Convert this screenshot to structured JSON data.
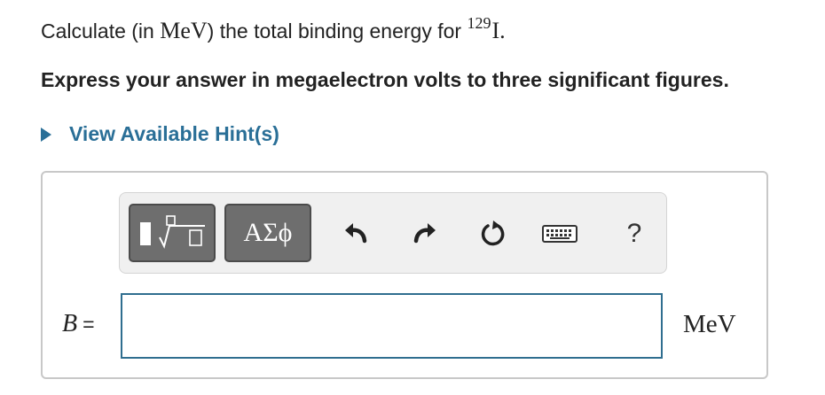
{
  "question": {
    "prefix": "Calculate (in ",
    "unit": "MeV",
    "middle": ") the total binding energy for ",
    "mass_number": "129",
    "element": "I",
    "suffix": "."
  },
  "instruction": "Express your answer in megaelectron volts to three significant figures.",
  "hint": {
    "label": "View Available Hint(s)"
  },
  "toolbar": {
    "symbols_label": "ΑΣϕ",
    "help_label": "?",
    "icons": [
      "templates-icon",
      "undo-icon",
      "redo-icon",
      "reset-icon",
      "keyboard-icon",
      "help-icon"
    ]
  },
  "answer": {
    "variable": "B",
    "equals": "=",
    "value": "",
    "unit": "MeV"
  },
  "colors": {
    "hint_link": "#2a6f97",
    "input_border": "#2f6e8f",
    "toolbar_button": "#6e6e6e",
    "toolbar_bg": "#f0f0f0"
  }
}
